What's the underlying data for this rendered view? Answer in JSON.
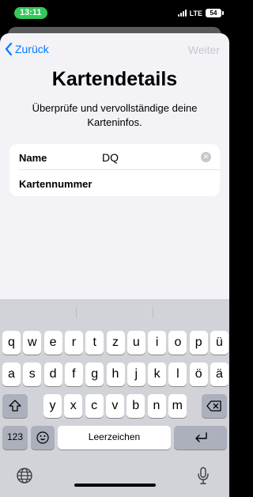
{
  "status": {
    "time": "13:11",
    "network": "LTE",
    "battery": "54"
  },
  "nav": {
    "back_label": "Zurück",
    "next_label": "Weiter"
  },
  "page": {
    "title": "Kartendetails",
    "subtitle": "Überprüfe und vervollständige deine Karteninfos."
  },
  "form": {
    "name_label": "Name",
    "name_value": "DQ",
    "number_label": "Kartennummer",
    "number_value": ""
  },
  "keyboard": {
    "row1": [
      "q",
      "w",
      "e",
      "r",
      "t",
      "z",
      "u",
      "i",
      "o",
      "p",
      "ü"
    ],
    "row2": [
      "a",
      "s",
      "d",
      "f",
      "g",
      "h",
      "j",
      "k",
      "l",
      "ö",
      "ä"
    ],
    "row3": [
      "y",
      "x",
      "c",
      "v",
      "b",
      "n",
      "m"
    ],
    "numbers_label": "123",
    "space_label": "Leerzeichen",
    "icons": {
      "shift": "shift-icon",
      "delete": "delete-icon",
      "emoji": "emoji-icon",
      "return": "return-icon",
      "globe": "globe-icon",
      "mic": "mic-icon"
    }
  },
  "colors": {
    "accent": "#007aff",
    "status_green": "#34c759",
    "disabled": "#c7c7cc"
  }
}
